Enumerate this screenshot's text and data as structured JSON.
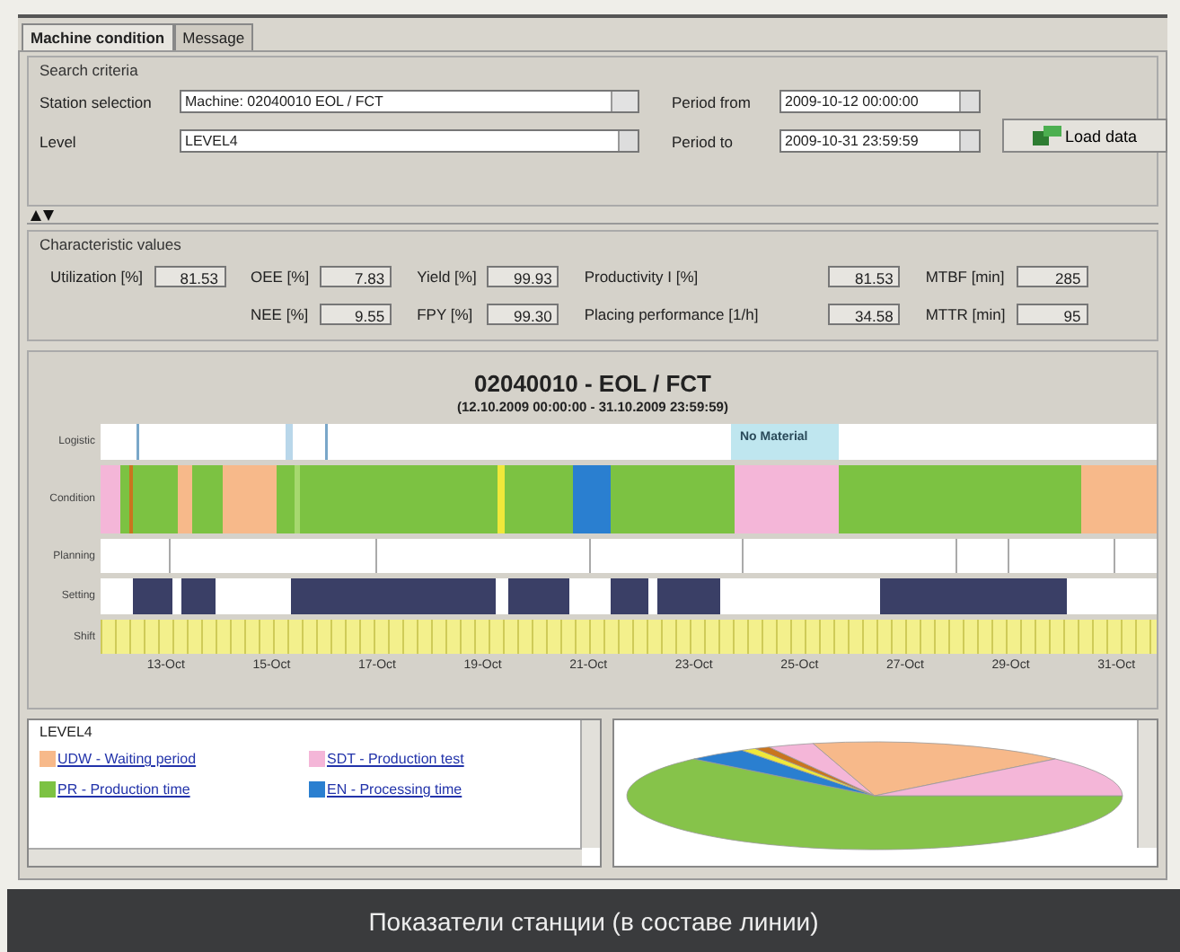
{
  "tabs": [
    {
      "label": "Machine condition",
      "selected": true
    },
    {
      "label": "Message",
      "selected": false
    }
  ],
  "search_criteria": {
    "title": "Search criteria",
    "station_label": "Station selection",
    "station_value": "Machine: 02040010 EOL / FCT",
    "level_label": "Level",
    "level_value": "LEVEL4",
    "period_from_label": "Period from",
    "period_from_value": "2009-10-12 00:00:00",
    "period_to_label": "Period to",
    "period_to_value": "2009-10-31 23:59:59",
    "load_button": "Load data"
  },
  "characteristic_values": {
    "title": "Characteristic values",
    "columns": [
      [
        {
          "label": "Utilization [%]",
          "value": "81.53"
        }
      ],
      [
        {
          "label": "OEE [%]",
          "value": "7.83"
        },
        {
          "label": "NEE [%]",
          "value": "9.55"
        }
      ],
      [
        {
          "label": "Yield [%]",
          "value": "99.93"
        },
        {
          "label": "FPY [%]",
          "value": "99.30"
        }
      ],
      [
        {
          "label": "Productivity I [%]",
          "value": "81.53"
        },
        {
          "label": "Placing performance [1/h]",
          "value": "34.58"
        }
      ],
      [
        {
          "label": "MTBF [min]",
          "value": "285"
        },
        {
          "label": "MTTR [min]",
          "value": "95"
        }
      ]
    ]
  },
  "chart": {
    "title": "02040010 - EOL / FCT",
    "subtitle": "(12.10.2009 00:00:00 - 31.10.2009 23:59:59)",
    "rows": [
      "Logistic",
      "Condition",
      "Planning",
      "Setting",
      "Shift"
    ],
    "segment_label": "No Material",
    "dates": [
      "13-Oct",
      "15-Oct",
      "17-Oct",
      "19-Oct",
      "21-Oct",
      "23-Oct",
      "25-Oct",
      "27-Oct",
      "29-Oct",
      "31-Oct"
    ]
  },
  "legend": {
    "title": "LEVEL4",
    "items": [
      {
        "label": "UDW - Waiting period",
        "color": "#f7b98a"
      },
      {
        "label": "SDT - Production test",
        "color": "#f4b6d8"
      },
      {
        "label": "PR - Production time",
        "color": "#7cc242"
      },
      {
        "label": "EN - Processing time",
        "color": "#2a7fd0"
      }
    ]
  },
  "caption": "Показатели станции (в составе линии)"
}
